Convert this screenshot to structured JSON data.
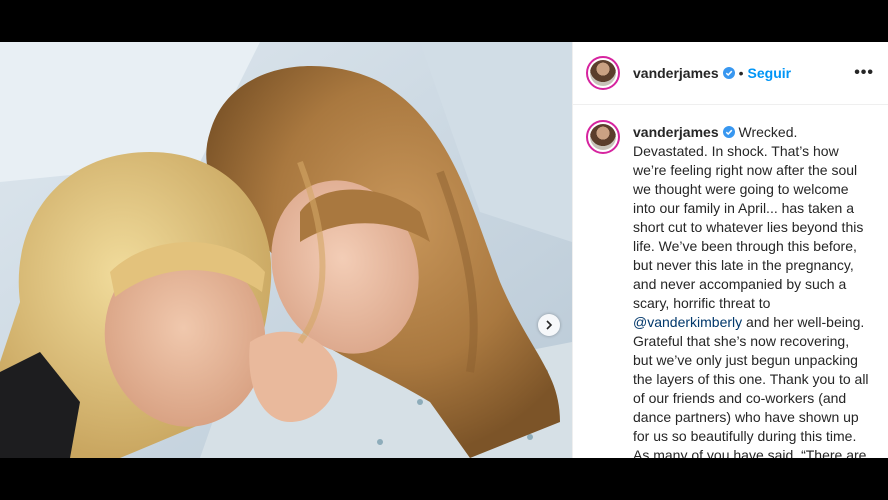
{
  "post": {
    "username": "vanderjames",
    "separator": "•",
    "follow_label": "Seguir",
    "more_label": "•••",
    "caption_start": "Wrecked. Devastated. In shock. That’s how we’re feeling right now after the soul we thought were going to welcome into our family in April... has taken a short cut to whatever lies beyond this life. We’ve been through this before, but never this late in the pregnancy, and never accompanied by such a scary, horrific threat to ",
    "mention": "@vanderkimberly",
    "caption_end": " and her well-being. Grateful that she’s now recovering, but we’ve only just begun unpacking the layers of this one. Thank you to all of our friends and co-workers (and dance partners) who have shown up for us so beautifully during this time. As many of you have said, “There are no words…” and it’s true. Which is why in a time like this it’s enough to",
    "icons": {
      "verified": "verified-badge-icon",
      "next": "chevron-right-icon",
      "more": "more-options-icon"
    },
    "colors": {
      "follow": "#0095f6",
      "verified": "#3897f0",
      "mention": "#00376b",
      "text": "#262626"
    }
  }
}
